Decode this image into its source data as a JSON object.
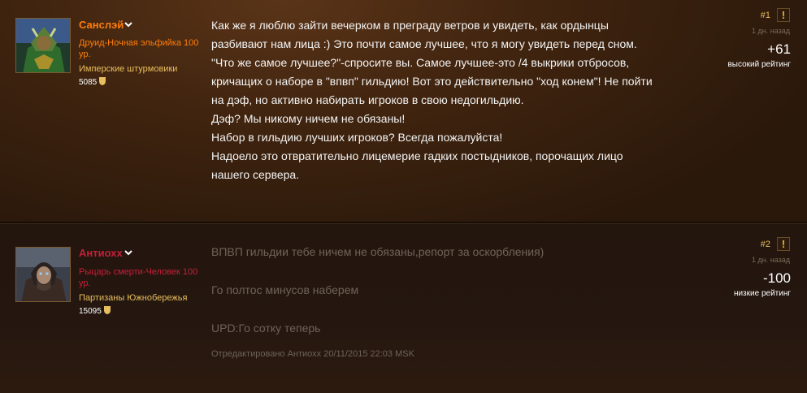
{
  "posts": [
    {
      "author": {
        "name": "Санслэй",
        "name_color": "#ff7d0a",
        "class_line": "Друид-Ночная эльфийка 100 ур.",
        "class_color": "#ff7d0a",
        "guild": "Имперские штурмовики",
        "achievement_points": "5085"
      },
      "post_number": "#1",
      "time_ago": "1 дн. назад",
      "score": "+61",
      "rating_label": "высокий рейтинг",
      "lines": [
        "Как же я люблю зайти вечерком в преграду ветров и увидеть, как ордынцы",
        "разбивают нам лица :) Это почти самое лучшее, что я могу увидеть перед сном.",
        "\"Что же самое лучшее?\"-спросите вы. Самое лучшее-это /4 выкрики отбросов,",
        "кричащих о наборе в \"впвп\" гильдию! Вот это действительно \"ход конем\"! Не пойти",
        "на дэф, но активно набирать игроков в свою недогильдию.",
        "Дэф? Мы никому ничем не обязаны!",
        "Набор в гильдию лучших игроков? Всегда пожалуйста!",
        "Надоело это отвратительно лицемерие гадких постыдников, порочащих лицо",
        "нашего сервера."
      ]
    },
    {
      "author": {
        "name": "Антиохх",
        "name_color": "#c41f3b",
        "class_line": "Рыцарь смерти-Человек 100 ур.",
        "class_color": "#c41f3b",
        "guild": "Партизаны Южнобережья",
        "achievement_points": "15095"
      },
      "post_number": "#2",
      "time_ago": "1 дн. назад",
      "score": "-100",
      "rating_label": "низкие рейтинг",
      "lines": [
        "ВПВП гильдии тебе ничем не обязаны,репорт за оскорбления)",
        "Го полтос минусов наберем",
        "UPD:Го сотку теперь"
      ],
      "edited_note": "Отредактировано Антиохх 20/11/2015 22:03 MSK"
    }
  ],
  "icons": {
    "report": "!",
    "chevron": "chevron-down-icon",
    "achievement": "shield-icon"
  }
}
